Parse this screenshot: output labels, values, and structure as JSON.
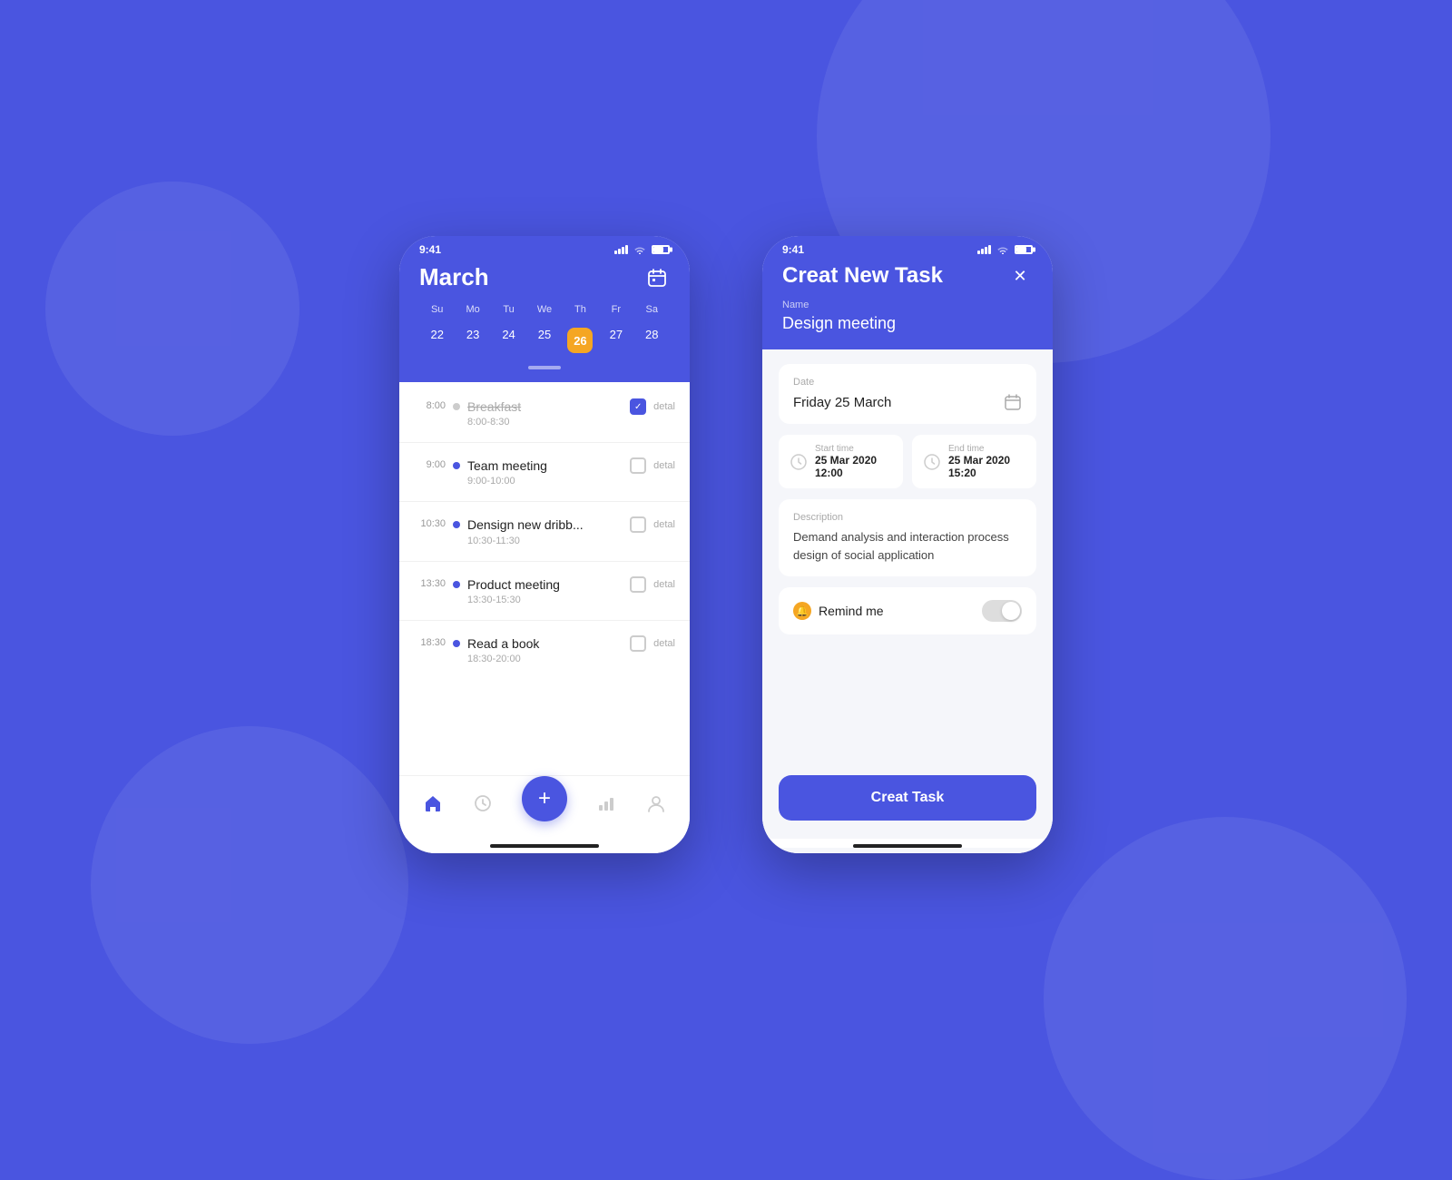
{
  "background_color": "#4A55E0",
  "phone1": {
    "status_bar": {
      "time": "9:41"
    },
    "header": {
      "month": "March",
      "weekdays": [
        "Su",
        "Mo",
        "Tu",
        "We",
        "Th",
        "Fr",
        "Sa"
      ],
      "dates": [
        "22",
        "23",
        "24",
        "25",
        "26",
        "27",
        "28"
      ],
      "active_date": "26"
    },
    "tasks": [
      {
        "time": "8:00",
        "title": "Breakfast",
        "subtitle": "8:00-8:30",
        "done": true,
        "checked": true
      },
      {
        "time": "9:00",
        "title": "Team meeting",
        "subtitle": "9:00-10:00",
        "done": false,
        "checked": false
      },
      {
        "time": "10:30",
        "title": "Densign new dribb...",
        "subtitle": "10:30-11:30",
        "done": false,
        "checked": false
      },
      {
        "time": "13:30",
        "title": "Product meeting",
        "subtitle": "13:30-15:30",
        "done": false,
        "checked": false
      },
      {
        "time": "18:30",
        "title": "Read a book",
        "subtitle": "18:30-20:00",
        "done": false,
        "checked": false
      }
    ],
    "nav": {
      "items": [
        "home",
        "clock",
        "plus",
        "chart",
        "profile"
      ]
    }
  },
  "phone2": {
    "status_bar": {
      "time": "9:41"
    },
    "header": {
      "title": "Creat New Task",
      "name_label": "Name",
      "name_value": "Design meeting"
    },
    "form": {
      "date_label": "Date",
      "date_value": "Friday 25 March",
      "start_time_label": "Start time",
      "start_time_value": "25 Mar 2020  12:00",
      "end_time_label": "End time",
      "end_time_value": "25 Mar 2020  15:20",
      "description_label": "Description",
      "description_value": "Demand analysis and interaction process design of social application",
      "remind_label": "Remind me"
    },
    "button": {
      "label": "Creat Task"
    }
  }
}
